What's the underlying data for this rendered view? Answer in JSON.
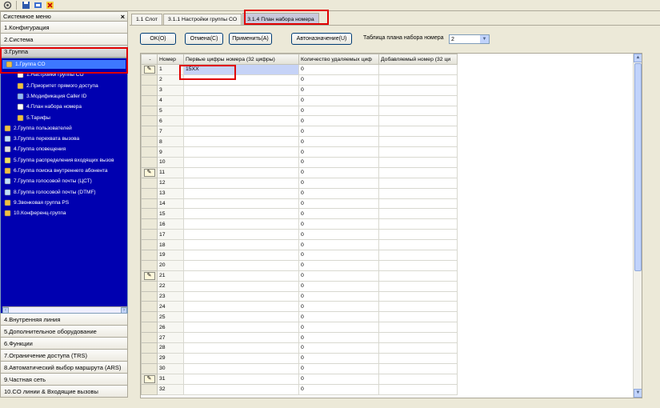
{
  "toolbar": {
    "icons": [
      "settings-icon",
      "save-icon",
      "connect-icon",
      "disconnect-icon"
    ]
  },
  "left": {
    "title": "Системное меню",
    "close": "×",
    "menu_top": [
      {
        "label": "1.Конфигурация"
      },
      {
        "label": "2.Система"
      },
      {
        "label": "3.Группа"
      }
    ],
    "tree": [
      {
        "label": "1.Группа CO",
        "indent": 0,
        "selected": true,
        "icon": "group-co-icon"
      },
      {
        "label": "1.Настройки группы CO",
        "indent": 1,
        "icon": "settings-doc-icon"
      },
      {
        "label": "2.Приоритет прямого доступа",
        "indent": 1,
        "icon": "priority-icon"
      },
      {
        "label": "3.Модификация Caller ID",
        "indent": 1,
        "icon": "callerid-icon"
      },
      {
        "label": "4.План набора номера",
        "indent": 1,
        "icon": "dial-plan-icon"
      },
      {
        "label": "5.Тарифы",
        "indent": 1,
        "icon": "tariff-icon"
      },
      {
        "label": "2.Группа пользователей",
        "indent": 0,
        "icon": "users-group-icon"
      },
      {
        "label": "3.Группа перехвата вызова",
        "indent": 0,
        "icon": "pickup-icon"
      },
      {
        "label": "4.Группа оповещения",
        "indent": 0,
        "icon": "paging-icon"
      },
      {
        "label": "5.Группа распределения входящих вызов",
        "indent": 0,
        "icon": "distribution-icon"
      },
      {
        "label": "6.Группа поиска внутреннего абонента",
        "indent": 0,
        "icon": "hunt-icon"
      },
      {
        "label": "7.Группа голосовой почты (ЦСТ)",
        "indent": 0,
        "icon": "voicemail-icon"
      },
      {
        "label": "8.Группа голосовой почты (DTMF)",
        "indent": 0,
        "icon": "voicemail-dtmf-icon"
      },
      {
        "label": "9.Звонковая группа PS",
        "indent": 0,
        "icon": "ring-group-icon"
      },
      {
        "label": "10.Конференц-группа",
        "indent": 0,
        "icon": "conference-icon"
      }
    ],
    "menu_bottom": [
      {
        "label": "4.Внутренняя линия"
      },
      {
        "label": "5.Дополнительное оборудование"
      },
      {
        "label": "6.Функции"
      },
      {
        "label": "7.Ограничение доступа (TRS)"
      },
      {
        "label": "8.Автоматический выбор маршрута (ARS)"
      },
      {
        "label": "9.Частная сеть"
      },
      {
        "label": "10.CO линии & Входящие вызовы"
      }
    ]
  },
  "tabs": [
    "1.1 Слот",
    "3.1.1 Настройки группы CO",
    "3.1.4 План набора номера"
  ],
  "buttons": {
    "ok": "OK(O)",
    "cancel": "Отмена(C)",
    "apply": "Применить(A)",
    "auto": "Автоназначение(U)"
  },
  "table_select": {
    "label": "Таблица плана набора номера",
    "value": "2"
  },
  "grid": {
    "headers": {
      "collapse": "-",
      "num": "Номер",
      "first_digits": "Первые цифры номера (32 цифры)",
      "remove_count": "Количество удаляемых циф",
      "added": "Добавляемый номер (32 ци"
    },
    "rows": [
      {
        "n": "1",
        "digits": "15XX",
        "remove": "0",
        "added": ""
      },
      {
        "n": "2",
        "digits": "",
        "remove": "0",
        "added": ""
      },
      {
        "n": "3",
        "digits": "",
        "remove": "0",
        "added": ""
      },
      {
        "n": "4",
        "digits": "",
        "remove": "0",
        "added": ""
      },
      {
        "n": "5",
        "digits": "",
        "remove": "0",
        "added": ""
      },
      {
        "n": "6",
        "digits": "",
        "remove": "0",
        "added": ""
      },
      {
        "n": "7",
        "digits": "",
        "remove": "0",
        "added": ""
      },
      {
        "n": "8",
        "digits": "",
        "remove": "0",
        "added": ""
      },
      {
        "n": "9",
        "digits": "",
        "remove": "0",
        "added": ""
      },
      {
        "n": "10",
        "digits": "",
        "remove": "0",
        "added": ""
      },
      {
        "n": "11",
        "digits": "",
        "remove": "0",
        "added": ""
      },
      {
        "n": "12",
        "digits": "",
        "remove": "0",
        "added": ""
      },
      {
        "n": "13",
        "digits": "",
        "remove": "0",
        "added": ""
      },
      {
        "n": "14",
        "digits": "",
        "remove": "0",
        "added": ""
      },
      {
        "n": "15",
        "digits": "",
        "remove": "0",
        "added": ""
      },
      {
        "n": "16",
        "digits": "",
        "remove": "0",
        "added": ""
      },
      {
        "n": "17",
        "digits": "",
        "remove": "0",
        "added": ""
      },
      {
        "n": "18",
        "digits": "",
        "remove": "0",
        "added": ""
      },
      {
        "n": "19",
        "digits": "",
        "remove": "0",
        "added": ""
      },
      {
        "n": "20",
        "digits": "",
        "remove": "0",
        "added": ""
      },
      {
        "n": "21",
        "digits": "",
        "remove": "0",
        "added": ""
      },
      {
        "n": "22",
        "digits": "",
        "remove": "0",
        "added": ""
      },
      {
        "n": "23",
        "digits": "",
        "remove": "0",
        "added": ""
      },
      {
        "n": "24",
        "digits": "",
        "remove": "0",
        "added": ""
      },
      {
        "n": "25",
        "digits": "",
        "remove": "0",
        "added": ""
      },
      {
        "n": "26",
        "digits": "",
        "remove": "0",
        "added": ""
      },
      {
        "n": "27",
        "digits": "",
        "remove": "0",
        "added": ""
      },
      {
        "n": "28",
        "digits": "",
        "remove": "0",
        "added": ""
      },
      {
        "n": "29",
        "digits": "",
        "remove": "0",
        "added": ""
      },
      {
        "n": "30",
        "digits": "",
        "remove": "0",
        "added": ""
      },
      {
        "n": "31",
        "digits": "",
        "remove": "0",
        "added": ""
      },
      {
        "n": "32",
        "digits": "",
        "remove": "0",
        "added": ""
      }
    ],
    "edit_rows": [
      "1",
      "11",
      "21",
      "31"
    ]
  },
  "colors": {
    "tree_bg": "#0000B0",
    "selection": "#3D78FF",
    "highlight": "#E00000"
  }
}
